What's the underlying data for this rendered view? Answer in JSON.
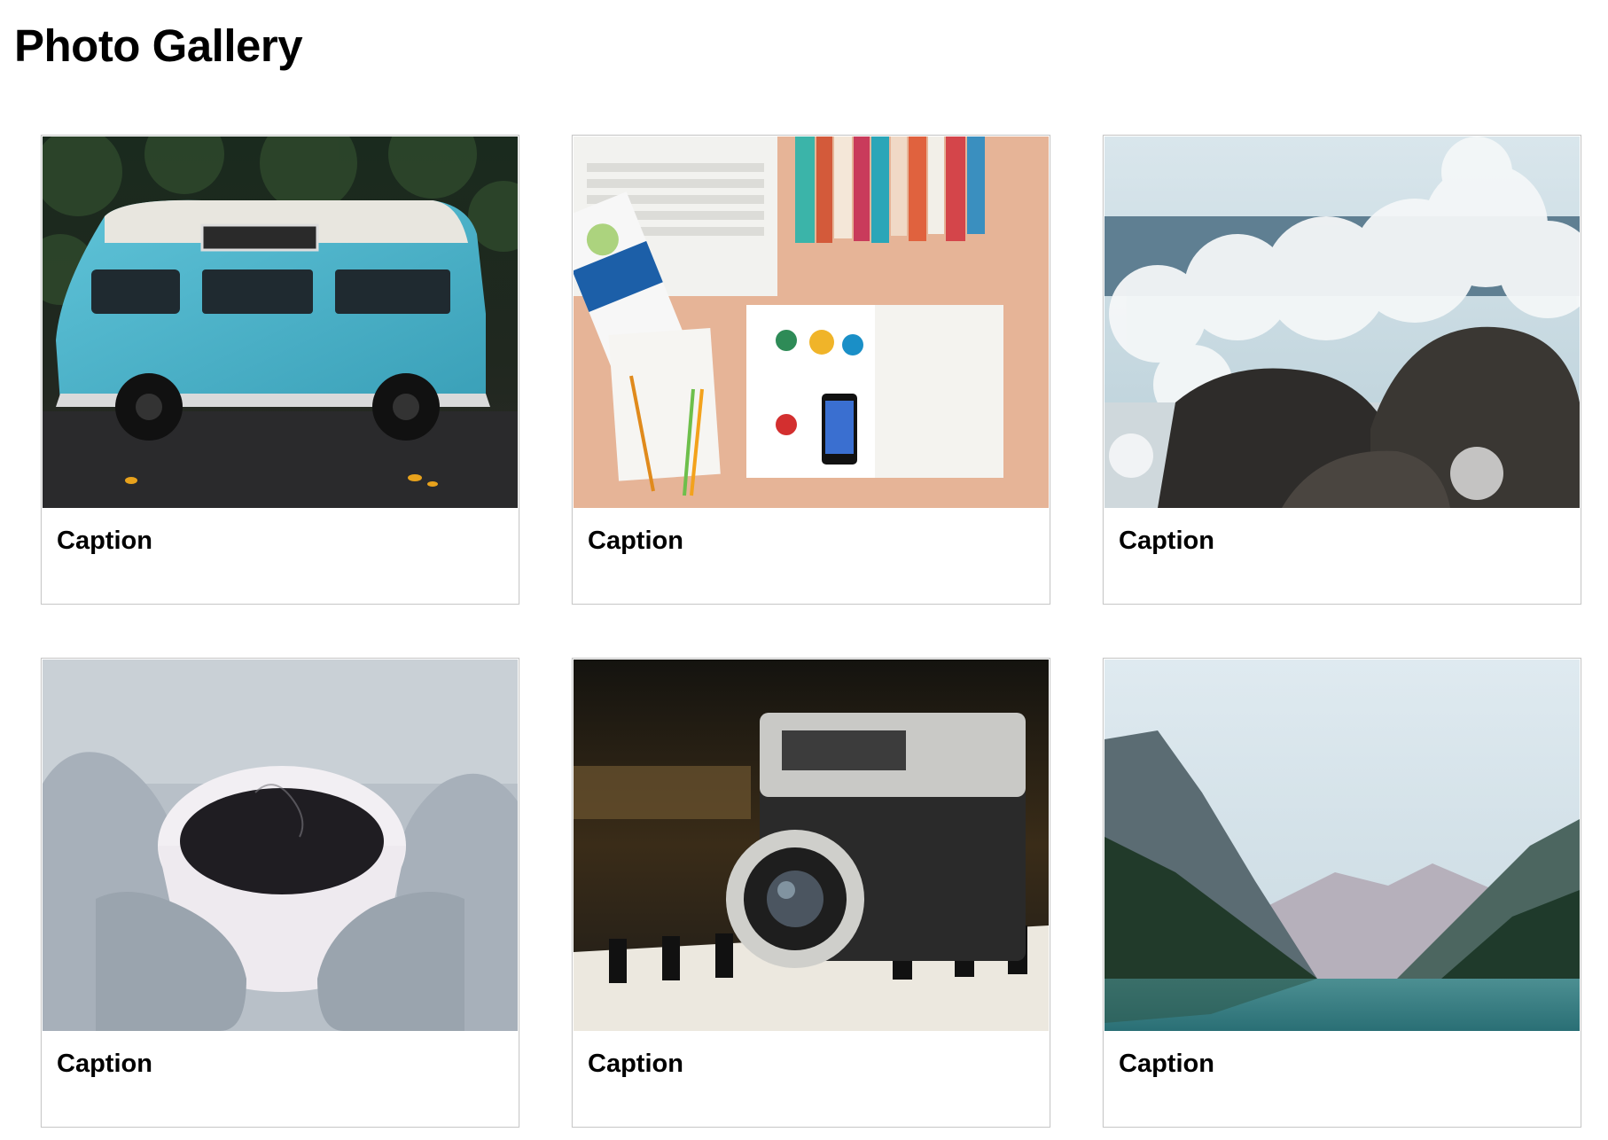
{
  "page": {
    "title": "Photo Gallery"
  },
  "gallery": {
    "items": [
      {
        "caption": "Caption",
        "image": "vintage-blue-van-photo"
      },
      {
        "caption": "Caption",
        "image": "desk-flatlay-laptop-magazine-photo"
      },
      {
        "caption": "Caption",
        "image": "ocean-wave-splash-rocks-photo"
      },
      {
        "caption": "Caption",
        "image": "coffee-cup-knitted-mittens-photo"
      },
      {
        "caption": "Caption",
        "image": "vintage-camera-on-piano-photo"
      },
      {
        "caption": "Caption",
        "image": "mountain-lake-valley-photo"
      }
    ]
  }
}
